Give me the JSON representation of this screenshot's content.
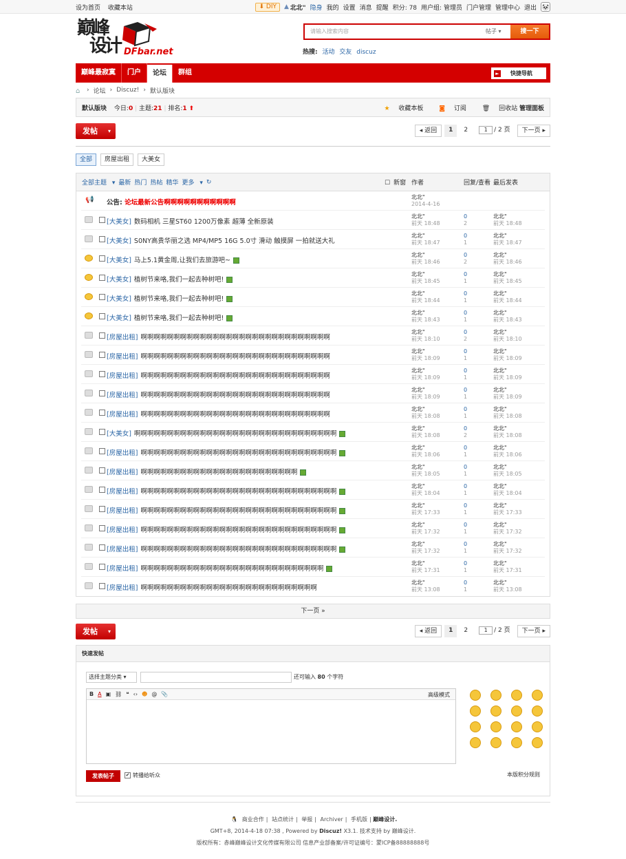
{
  "topbar": {
    "left": [
      "设为首页",
      "收藏本站"
    ],
    "diy": "DIY",
    "user": "北北\"",
    "links": [
      "隐身",
      "我的",
      "设置",
      "消息",
      "提醒",
      "积分: 78",
      "用户组: 管理员",
      "门户管理",
      "管理中心",
      "退出"
    ]
  },
  "header": {
    "logo_top": "巅峰",
    "logo_bottom": "设计",
    "logo_site": "DFbar.net",
    "search_placeholder": "请输入搜索内容",
    "search_type": "帖子",
    "search_button": "搜一下",
    "hot_label": "热搜:",
    "hot": [
      "活动",
      "交友",
      "discuz"
    ]
  },
  "nav": {
    "items": [
      "巅峰最寂寞",
      "门户",
      "论坛",
      "群组"
    ],
    "quick": "快捷导航"
  },
  "breadcrumb": [
    "论坛",
    "Discuz!",
    "默认版块"
  ],
  "forum": {
    "name": "默认版块",
    "today_label": "今日:",
    "today": "0",
    "topics_label": "主题:",
    "topics": "21",
    "rank_label": "排名:",
    "rank": "1",
    "actions": [
      "收藏本板",
      "订阅",
      "回收站",
      "管理面板"
    ]
  },
  "post_button": "发帖",
  "pager": {
    "back": "返回",
    "pages": [
      "1",
      "2"
    ],
    "input": "1",
    "total": "/ 2 页",
    "next": "下一页"
  },
  "types": [
    "全部",
    "房屋出租",
    "大美女"
  ],
  "thead": {
    "filters": [
      "全部主题",
      "最新",
      "热门",
      "热帖",
      "精华",
      "更多"
    ],
    "new_window": "新窗",
    "author": "作者",
    "replies": "回复/查看",
    "lastpost": "最后发表"
  },
  "announcement": {
    "label": "公告:",
    "title": "论坛最新公告啊啊啊啊啊啊啊啊啊啊啊",
    "author": "北北\"",
    "date": "2014-4-16"
  },
  "threads": [
    {
      "tag": "[大美女]",
      "title": "数码相机 三星ST60 1200万像素 超薄 全新原装",
      "author": "北北\"",
      "date": "前天 18:48",
      "r": "0",
      "v": "2",
      "la": "北北\"",
      "ld": "前天 18:48",
      "attach": false,
      "icon": "gray"
    },
    {
      "tag": "[大美女]",
      "title": "S0NY高贵华丽之选 MP4/MP5 16G 5.0寸 滑动 触摸屏 一拍就送大礼",
      "author": "北北\"",
      "date": "前天 18:47",
      "r": "0",
      "v": "1",
      "la": "北北\"",
      "ld": "前天 18:47",
      "attach": false,
      "icon": "gray"
    },
    {
      "tag": "[大美女]",
      "title": "马上5.1黄金周,让我们去旅游吧~",
      "author": "北北\"",
      "date": "前天 18:46",
      "r": "0",
      "v": "2",
      "la": "北北\"",
      "ld": "前天 18:46",
      "attach": true,
      "icon": "smile"
    },
    {
      "tag": "[大美女]",
      "title": "植树节来咯,我们一起去种树吧!",
      "author": "北北\"",
      "date": "前天 18:45",
      "r": "0",
      "v": "1",
      "la": "北北\"",
      "ld": "前天 18:45",
      "attach": true,
      "icon": "smile"
    },
    {
      "tag": "[大美女]",
      "title": "植树节来咯,我们一起去种树吧!",
      "author": "北北\"",
      "date": "前天 18:44",
      "r": "0",
      "v": "1",
      "la": "北北\"",
      "ld": "前天 18:44",
      "attach": true,
      "icon": "smile"
    },
    {
      "tag": "[大美女]",
      "title": "植树节来咯,我们一起去种树吧!",
      "author": "北北\"",
      "date": "前天 18:43",
      "r": "0",
      "v": "1",
      "la": "北北\"",
      "ld": "前天 18:43",
      "attach": true,
      "icon": "smile"
    },
    {
      "tag": "[房屋出租]",
      "title": "啊啊啊啊啊啊啊啊啊啊啊啊啊啊啊啊啊啊啊啊啊啊啊啊啊啊啊啊啊",
      "author": "北北\"",
      "date": "前天 18:10",
      "r": "0",
      "v": "2",
      "la": "北北\"",
      "ld": "前天 18:10",
      "attach": false,
      "icon": "gray"
    },
    {
      "tag": "[房屋出租]",
      "title": "啊啊啊啊啊啊啊啊啊啊啊啊啊啊啊啊啊啊啊啊啊啊啊啊啊啊啊啊啊",
      "author": "北北\"",
      "date": "前天 18:09",
      "r": "0",
      "v": "1",
      "la": "北北\"",
      "ld": "前天 18:09",
      "attach": false,
      "icon": "gray"
    },
    {
      "tag": "[房屋出租]",
      "title": "啊啊啊啊啊啊啊啊啊啊啊啊啊啊啊啊啊啊啊啊啊啊啊啊啊啊啊啊啊",
      "author": "北北\"",
      "date": "前天 18:09",
      "r": "0",
      "v": "1",
      "la": "北北\"",
      "ld": "前天 18:09",
      "attach": false,
      "icon": "gray"
    },
    {
      "tag": "[房屋出租]",
      "title": "啊啊啊啊啊啊啊啊啊啊啊啊啊啊啊啊啊啊啊啊啊啊啊啊啊啊啊啊啊",
      "author": "北北\"",
      "date": "前天 18:09",
      "r": "0",
      "v": "1",
      "la": "北北\"",
      "ld": "前天 18:09",
      "attach": false,
      "icon": "gray"
    },
    {
      "tag": "[房屋出租]",
      "title": "啊啊啊啊啊啊啊啊啊啊啊啊啊啊啊啊啊啊啊啊啊啊啊啊啊啊啊啊啊",
      "author": "北北\"",
      "date": "前天 18:08",
      "r": "0",
      "v": "1",
      "la": "北北\"",
      "ld": "前天 18:08",
      "attach": false,
      "icon": "gray"
    },
    {
      "tag": "[大美女]",
      "title": "啊啊啊啊啊啊啊啊啊啊啊啊啊啊啊啊啊啊啊啊啊啊啊啊啊啊啊啊啊啊啊",
      "author": "北北\"",
      "date": "前天 18:08",
      "r": "0",
      "v": "2",
      "la": "北北\"",
      "ld": "前天 18:08",
      "attach": true,
      "icon": "gray"
    },
    {
      "tag": "[房屋出租]",
      "title": "啊啊啊啊啊啊啊啊啊啊啊啊啊啊啊啊啊啊啊啊啊啊啊啊啊啊啊啊啊啊",
      "author": "北北\"",
      "date": "前天 18:06",
      "r": "0",
      "v": "1",
      "la": "北北\"",
      "ld": "前天 18:06",
      "attach": true,
      "icon": "gray"
    },
    {
      "tag": "[房屋出租]",
      "title": "啊啊啊啊啊啊啊啊啊啊啊啊啊啊啊啊啊啊啊啊啊啊啊啊",
      "author": "北北\"",
      "date": "前天 18:05",
      "r": "0",
      "v": "1",
      "la": "北北\"",
      "ld": "前天 18:05",
      "attach": true,
      "icon": "gray"
    },
    {
      "tag": "[房屋出租]",
      "title": "啊啊啊啊啊啊啊啊啊啊啊啊啊啊啊啊啊啊啊啊啊啊啊啊啊啊啊啊啊啊",
      "author": "北北\"",
      "date": "前天 18:04",
      "r": "0",
      "v": "1",
      "la": "北北\"",
      "ld": "前天 18:04",
      "attach": true,
      "icon": "gray"
    },
    {
      "tag": "[房屋出租]",
      "title": "啊啊啊啊啊啊啊啊啊啊啊啊啊啊啊啊啊啊啊啊啊啊啊啊啊啊啊啊啊啊",
      "author": "北北\"",
      "date": "前天 17:33",
      "r": "0",
      "v": "1",
      "la": "北北\"",
      "ld": "前天 17:33",
      "attach": true,
      "icon": "gray"
    },
    {
      "tag": "[房屋出租]",
      "title": "啊啊啊啊啊啊啊啊啊啊啊啊啊啊啊啊啊啊啊啊啊啊啊啊啊啊啊啊啊啊",
      "author": "北北\"",
      "date": "前天 17:32",
      "r": "0",
      "v": "1",
      "la": "北北\"",
      "ld": "前天 17:32",
      "attach": true,
      "icon": "gray"
    },
    {
      "tag": "[房屋出租]",
      "title": "啊啊啊啊啊啊啊啊啊啊啊啊啊啊啊啊啊啊啊啊啊啊啊啊啊啊啊啊啊啊",
      "author": "北北\"",
      "date": "前天 17:32",
      "r": "0",
      "v": "1",
      "la": "北北\"",
      "ld": "前天 17:32",
      "attach": true,
      "icon": "gray"
    },
    {
      "tag": "[房屋出租]",
      "title": "啊啊啊啊啊啊啊啊啊啊啊啊啊啊啊啊啊啊啊啊啊啊啊啊啊啊啊啊",
      "author": "北北\"",
      "date": "前天 17:31",
      "r": "0",
      "v": "1",
      "la": "北北\"",
      "ld": "前天 17:31",
      "attach": true,
      "icon": "gray"
    },
    {
      "tag": "[房屋出租]",
      "title": "啊啊啊啊啊啊啊啊啊啊啊啊啊啊啊啊啊啊啊啊啊啊啊啊啊啊啊",
      "author": "北北\"",
      "date": "前天 13:08",
      "r": "0",
      "v": "1",
      "la": "北北\"",
      "ld": "前天 13:08",
      "attach": false,
      "icon": "gray"
    }
  ],
  "next_page": "下一页 »",
  "quickpost": {
    "title": "快速发帖",
    "select": "选择主题分类",
    "count_pre": "还可输入",
    "count": "80",
    "count_post": "个字符",
    "advanced": "高级模式",
    "submit": "发表帖子",
    "check": "转播给听众",
    "rules": "本版积分规则"
  },
  "footer": {
    "links": [
      "商业合作",
      "站点统计",
      "举报",
      "Archiver",
      "手机版",
      "巅峰设计."
    ],
    "line2_pre": "GMT+8, 2014-4-18 07:38 , Powered by",
    "line2_brand": "Discuz!",
    "line2_post": "X3.1. 技术支持 by 巅峰设计.",
    "line3": "版权所有：赤峰巅峰设计文化传媒有限公司    信息产业部备案/许可证编号：蒙ICP备88888888号"
  }
}
